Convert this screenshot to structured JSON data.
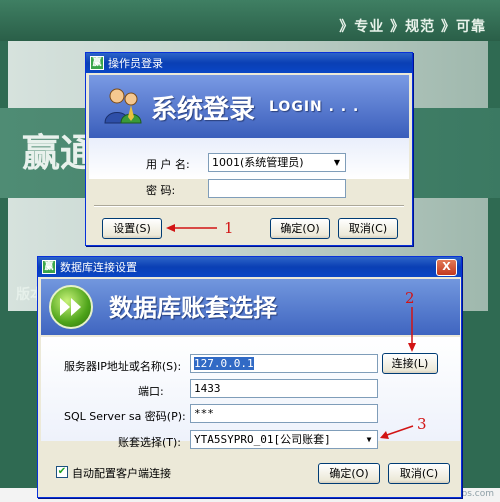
{
  "background": {
    "slogan": "》专业 》规范 》可靠",
    "big_text": "赢通",
    "version_text": "版本"
  },
  "login_dialog": {
    "title": "操作员登录",
    "icon_glyph": "赢",
    "banner_title": "系统登录",
    "banner_subtitle": "LOGIN . . .",
    "user_label": "用 户 名:",
    "user_value": "1001(系统管理员)",
    "password_label": "密     码:",
    "password_value": "",
    "settings_button": "设置(S)",
    "ok_button": "确定(O)",
    "cancel_button": "取消(C)"
  },
  "db_dialog": {
    "title": "数据库连接设置",
    "icon_glyph": "赢",
    "close_glyph": "X",
    "banner_title": "数据库账套选择",
    "server_label": "服务器IP地址或名称(S):",
    "server_value": "127.0.0.1",
    "connect_button": "连接(L)",
    "port_label": "端口:",
    "port_value": "1433",
    "sa_label": "SQL Server sa 密码(P):",
    "sa_value": "***",
    "account_label": "账套选择(T):",
    "account_value": "YTA5SYPRO_01[公司账套]",
    "auto_config_label": "自动配置客户端连接",
    "auto_config_checked": true,
    "ok_button": "确定(O)",
    "cancel_button": "取消(C)"
  },
  "annotations": {
    "one": "1",
    "two": "2",
    "three": "3",
    "color": "#d21414"
  },
  "watermark": "www.yt-pos.com"
}
